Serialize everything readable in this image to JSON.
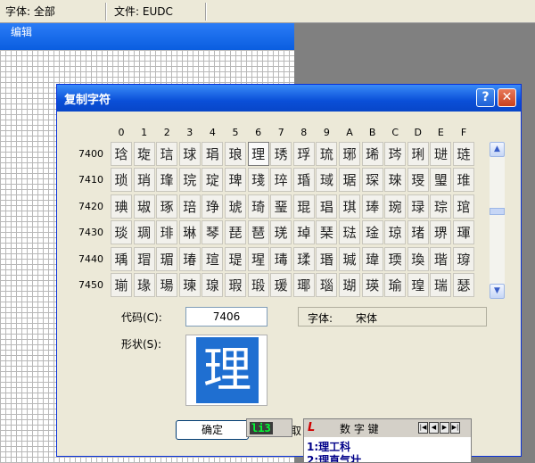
{
  "topbar": {
    "charset": "字体: 全部",
    "file": "文件: EUDC"
  },
  "edit_window": {
    "title": "编辑"
  },
  "dialog": {
    "title": "复制字符",
    "help_label": "?",
    "close_label": "✕",
    "column_headers": [
      "0",
      "1",
      "2",
      "3",
      "4",
      "5",
      "6",
      "7",
      "8",
      "9",
      "A",
      "B",
      "C",
      "D",
      "E",
      "F"
    ],
    "rows": [
      {
        "code": "7400",
        "chars": [
          "琀",
          "琁",
          "琂",
          "球",
          "琄",
          "琅",
          "理",
          "琇",
          "琈",
          "琉",
          "琊",
          "琋",
          "琌",
          "琍",
          "琎",
          "琏"
        ]
      },
      {
        "code": "7410",
        "chars": [
          "琐",
          "琑",
          "琒",
          "琓",
          "琔",
          "琕",
          "琖",
          "琗",
          "琘",
          "琙",
          "琚",
          "琛",
          "琜",
          "琝",
          "琞",
          "琟"
        ]
      },
      {
        "code": "7420",
        "chars": [
          "琠",
          "琡",
          "琢",
          "琣",
          "琤",
          "琥",
          "琦",
          "琧",
          "琨",
          "琩",
          "琪",
          "琫",
          "琬",
          "琭",
          "琮",
          "琯"
        ]
      },
      {
        "code": "7430",
        "chars": [
          "琰",
          "琱",
          "琲",
          "琳",
          "琴",
          "琵",
          "琶",
          "琷",
          "琸",
          "琹",
          "琺",
          "琻",
          "琼",
          "琽",
          "琾",
          "琿"
        ]
      },
      {
        "code": "7440",
        "chars": [
          "瑀",
          "瑁",
          "瑂",
          "瑃",
          "瑄",
          "瑅",
          "瑆",
          "瑇",
          "瑈",
          "瑉",
          "瑊",
          "瑋",
          "瑌",
          "瑍",
          "瑎",
          "瑏"
        ]
      },
      {
        "code": "7450",
        "chars": [
          "瑐",
          "瑑",
          "瑒",
          "瑓",
          "瑔",
          "瑕",
          "瑖",
          "瑗",
          "瑘",
          "瑙",
          "瑚",
          "瑛",
          "瑜",
          "瑝",
          "瑞",
          "瑟"
        ]
      }
    ],
    "selected": {
      "row": 0,
      "col": 6
    },
    "scroll_up": "▲",
    "scroll_down": "▼",
    "code_label": "代码(C):",
    "code_value": "7406",
    "font_label": "字体:",
    "font_value": "宋体",
    "shape_label": "形状(S):",
    "shape_char": "理",
    "ok_label": "确定",
    "cancel_partial": "取"
  },
  "ime": {
    "composition": "li3",
    "mode_title": "数 字 键",
    "logo": "L",
    "nav_buttons": [
      "|◀",
      "◀",
      "▶",
      "▶|"
    ],
    "candidates": [
      "1:理工科",
      "2:理直气壮"
    ]
  },
  "colors": {
    "title_blue": "#0a4fd8",
    "selection_blue": "#1f6fd1",
    "ime_green": "#00ff33"
  }
}
